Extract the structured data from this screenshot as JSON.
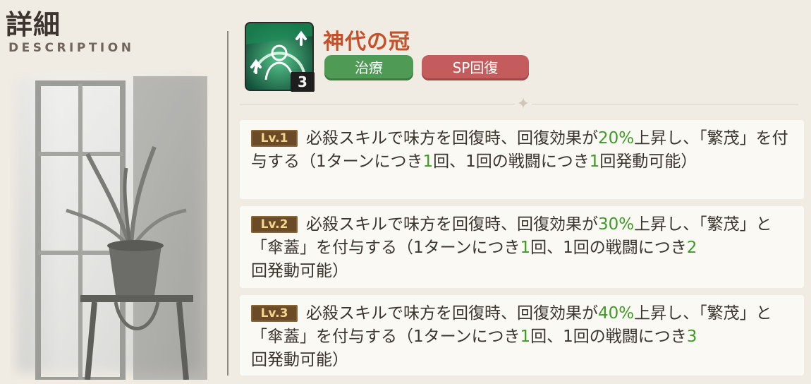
{
  "header": {
    "title": "詳細",
    "subtitle": "DESCRIPTION"
  },
  "skill": {
    "name": "神代の冠",
    "level_badge": "3",
    "tags": [
      {
        "label": "治療",
        "color": "#4f9a55"
      },
      {
        "label": "SP回復",
        "color": "#c45c5e"
      }
    ]
  },
  "levels": [
    {
      "badge": "Lv.1",
      "t1": "必殺スキルで味方を回復時、回復効果が",
      "v1": "20%",
      "t2": "上昇し、「繁茂」を付与する（1ターンにつき",
      "v2": "1",
      "t3": "回、1回の戦闘につき",
      "v3": "1",
      "t4": "回発動可能）"
    },
    {
      "badge": "Lv.2",
      "t1": "必殺スキルで味方を回復時、回復効果が",
      "v1": "30%",
      "t2": "上昇し、「繁茂」と「傘蓋」を付与する（1ターンにつき",
      "v2": "1",
      "t3": "回、1回の戦闘につき",
      "v3": "2",
      "t4": "回発動可能）"
    },
    {
      "badge": "Lv.3",
      "t1": "必殺スキルで味方を回復時、回復効果が",
      "v1": "40%",
      "t2": "上昇し、「繁茂」と「傘蓋」を付与する（1ターンにつき",
      "v2": "1",
      "t3": "回、1回の戦闘につき",
      "v3": "3",
      "t4": "回発動可能）"
    }
  ],
  "colors": {
    "accent_name": "#c5512a",
    "value_highlight": "#3f9a27",
    "level_badge_bg": "#6b4b27"
  },
  "icons": {
    "skill_icon": "crown-heal-icon",
    "divider": "sparkle-icon"
  }
}
